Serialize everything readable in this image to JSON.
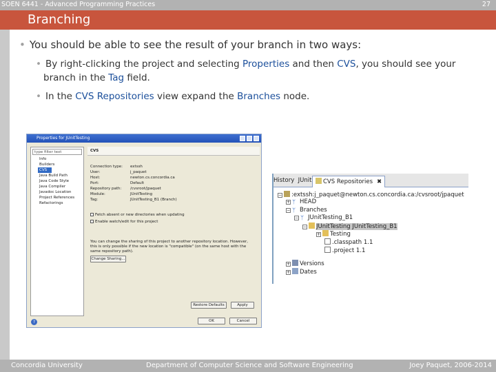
{
  "header": {
    "course": "SOEN 6441 - Advanced Programming Practices",
    "page_number": "27"
  },
  "slide": {
    "title": "Branching",
    "bullet1": "You should be able to see the result of your branch in two ways:",
    "sub1": {
      "a": "By right-clicking the project and selecting ",
      "kw1": "Properties",
      "b": " and then ",
      "kw2": "CVS",
      "c": ", you should see your",
      "d": "branch in the ",
      "kw3": "Tag",
      "e": " field."
    },
    "sub2": {
      "a": "In the ",
      "kw1": "CVS Repositories",
      "b": " view expand the ",
      "kw2": "Branches",
      "c": " node."
    }
  },
  "dialog": {
    "title": "Properties for JUnitTesting",
    "filter_placeholder": "type filter text",
    "nav_items": [
      "Info",
      "Builders",
      "CVS",
      "Java Build Path",
      "Java Code Style",
      "Java Compiler",
      "Javadoc Location",
      "Project References",
      "Refactorings"
    ],
    "pane_title": "CVS",
    "fields": [
      {
        "k": "Connection type:",
        "v": "extssh"
      },
      {
        "k": "User:",
        "v": "j_paquet"
      },
      {
        "k": "Host:",
        "v": "newton.cs.concordia.ca"
      },
      {
        "k": "Port:",
        "v": "Default"
      },
      {
        "k": "Repository path:",
        "v": "/cvsroot/jpaquet"
      },
      {
        "k": "Module:",
        "v": "JUnitTesting"
      },
      {
        "k": "Tag:",
        "v": "JUnitTesting_B1 (Branch)"
      }
    ],
    "check1": "Fetch absent or new directories when updating",
    "check2": "Enable watch/edit for this project",
    "note": "You can change the sharing of this project to another repository location. However, this is only possible if the new location is \"compatible\" (on the same host with the same repository path).",
    "change_sharing": "Change Sharing...",
    "restore_defaults": "Restore Defaults",
    "apply": "Apply",
    "ok": "OK",
    "cancel": "Cancel"
  },
  "cvs_view": {
    "tab_history": "History",
    "tab_junit": "JUnit",
    "tab_cvs": "CVS Repositories",
    "close": "✖",
    "rows": [
      ":extssh:j_paquet@newton.cs.concordia.ca:/cvsroot/jpaquet",
      "HEAD",
      "Branches",
      "JUnitTesting_B1",
      "JUnitTesting JUnitTesting_B1",
      "Testing",
      ".classpath 1.1",
      ".project 1.1",
      "Versions",
      "Dates"
    ]
  },
  "footer": {
    "left": "Concordia University",
    "center": "Department of Computer Science and Software Engineering",
    "right": "Joey Paquet, 2006-2014"
  },
  "colors": {
    "accent": "#c8553d",
    "keyword": "#1b4f9b",
    "bar": "#b2b2b2"
  }
}
